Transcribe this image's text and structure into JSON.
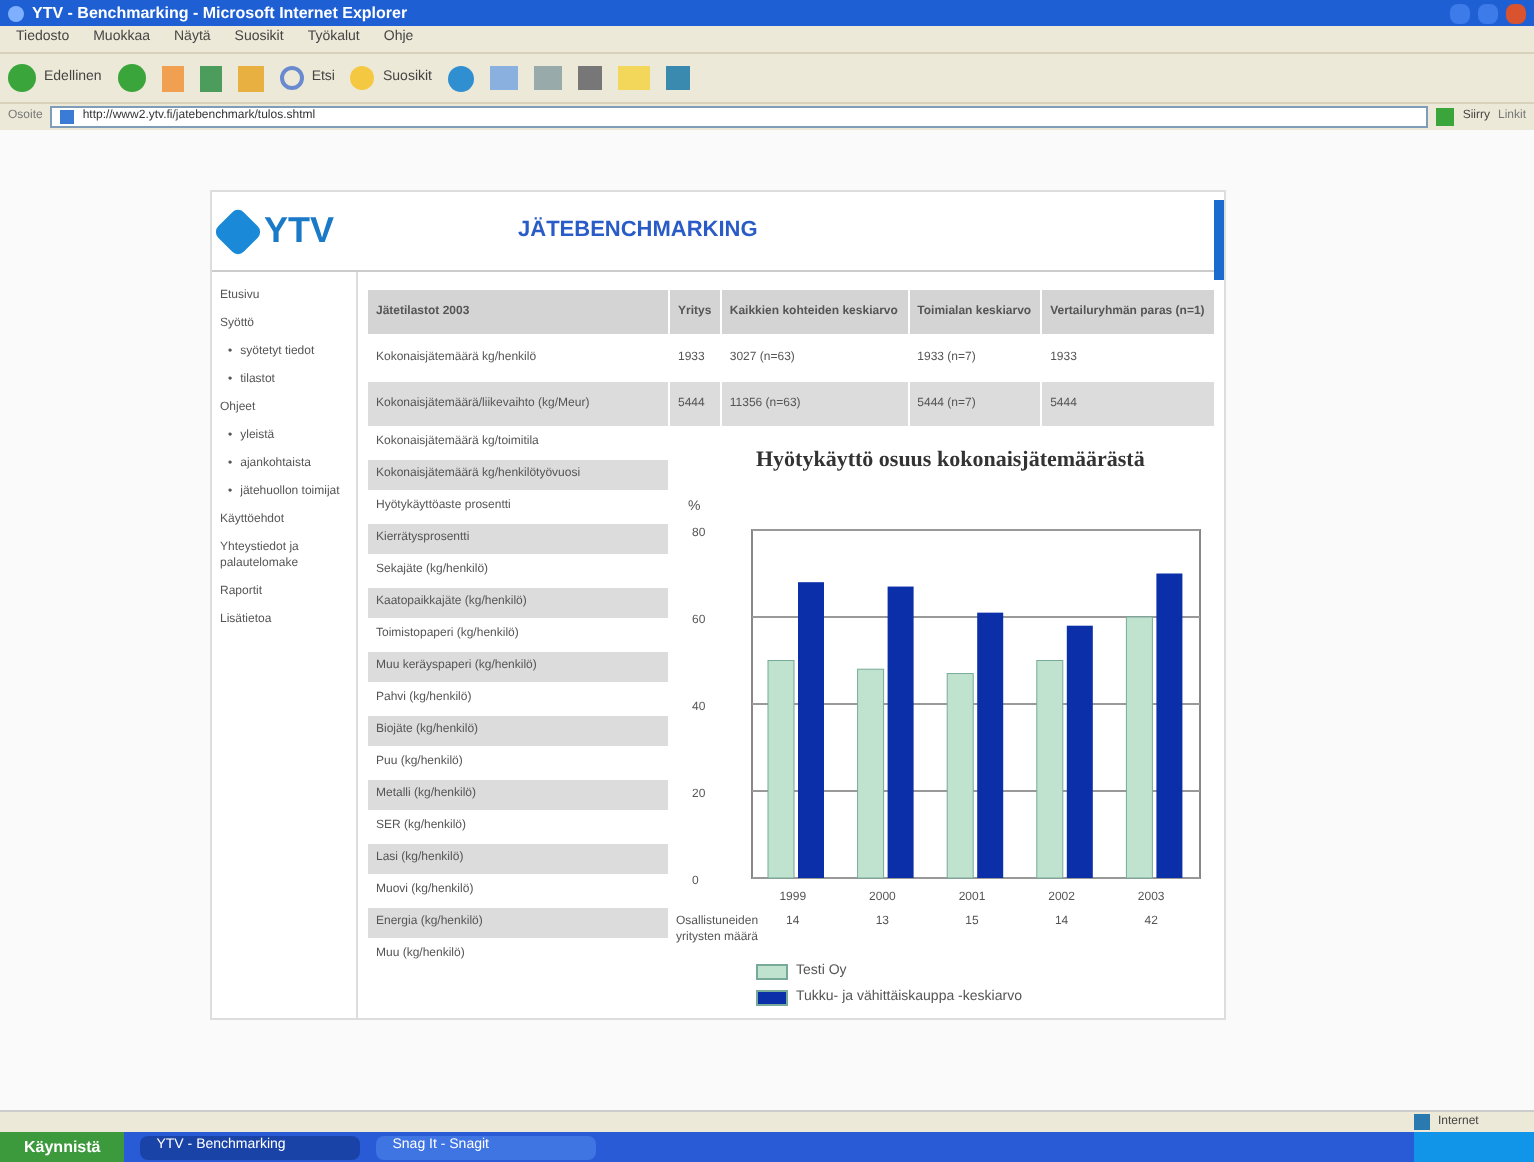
{
  "window": {
    "title": "YTV - Benchmarking - Microsoft Internet Explorer"
  },
  "menu": [
    "Tiedosto",
    "Muokkaa",
    "Näytä",
    "Suosikit",
    "Työkalut",
    "Ohje"
  ],
  "toolbar": {
    "back": "Edellinen",
    "search": "Etsi",
    "favorites": "Suosikit"
  },
  "address_bar": {
    "label": "Osoite",
    "value": "http://www2.ytv.fi/jatebenchmark/tulos.shtml",
    "go": "Siirry",
    "links": "Linkit"
  },
  "header": {
    "logo": "YTV",
    "title": "JÄTEBENCHMARKING"
  },
  "sidebar": {
    "items": [
      {
        "label": "Etusivu"
      },
      {
        "label": "Syöttö",
        "children": [
          {
            "bullet": "•",
            "label": "syötetyt tiedot"
          },
          {
            "bullet": "•",
            "label": "tilastot"
          }
        ]
      },
      {
        "label": "Ohjeet",
        "children": [
          {
            "bullet": "•",
            "label": "yleistä"
          },
          {
            "bullet": "•",
            "label": "ajankohtaista"
          },
          {
            "bullet": "•",
            "label": "jätehuollon toimijat"
          }
        ]
      },
      {
        "label": "Käyttöehdot"
      },
      {
        "label": "Yhteystiedot ja palautelomake"
      },
      {
        "label": "Raportit"
      },
      {
        "label": "Lisätietoa"
      }
    ]
  },
  "table": {
    "columns": [
      "Jätetilastot 2003",
      "Yritys",
      "Kaikkien kohteiden keskiarvo",
      "Toimialan keskiarvo",
      "Vertailuryhmän paras (n=1)"
    ],
    "rows": [
      [
        "Kokonaisjätemäärä kg/henkilö",
        "1933",
        "3027 (n=63)",
        "1933 (n=7)",
        "1933"
      ],
      [
        "Kokonaisjätemäärä/liikevaihto (kg/Meur)",
        "5444",
        "11356 (n=63)",
        "5444 (n=7)",
        "5444"
      ]
    ]
  },
  "indicators": [
    "Kokonaisjätemäärä kg/toimitila",
    "Kokonaisjätemäärä kg/henkilötyövuosi",
    "Hyötykäyttöaste prosentti",
    "Kierrätysprosentti",
    "Sekajäte (kg/henkilö)",
    "Kaatopaikkajäte (kg/henkilö)",
    "Toimistopaperi (kg/henkilö)",
    "Muu keräyspaperi (kg/henkilö)",
    "Pahvi (kg/henkilö)",
    "Biojäte (kg/henkilö)",
    "Puu (kg/henkilö)",
    "Metalli (kg/henkilö)",
    "SER (kg/henkilö)",
    "Lasi (kg/henkilö)",
    "Muovi (kg/henkilö)",
    "Energia (kg/henkilö)",
    "Muu (kg/henkilö)"
  ],
  "chart": {
    "participants_label": "Osallistuneiden yritysten määrä",
    "participants": [
      "14",
      "13",
      "15",
      "14",
      "42"
    ],
    "chart_data": {
      "type": "bar",
      "title": "Hyötykäyttö osuus kokonaisjätemäärästä",
      "ylabel": "%",
      "categories": [
        "1999",
        "2000",
        "2001",
        "2002",
        "2003"
      ],
      "ylim": [
        0,
        80
      ],
      "grid": true,
      "yticks": [
        0,
        20,
        40,
        60,
        80
      ],
      "series": [
        {
          "name": "Testi Oy",
          "color": "#bfe3cf",
          "values": [
            50,
            48,
            47,
            50,
            60
          ]
        },
        {
          "name": "Tukku- ja vähittäiskauppa -keskiarvo",
          "color": "#0a2fa8",
          "values": [
            68,
            67,
            61,
            58,
            70
          ]
        }
      ]
    }
  },
  "status_bar": {
    "zone": "Internet"
  },
  "taskbar": {
    "start": "Käynnistä",
    "tasks": [
      {
        "label": "YTV - Benchmarking",
        "selected": true
      },
      {
        "label": "Snag It - Snagit",
        "selected": false
      }
    ]
  }
}
